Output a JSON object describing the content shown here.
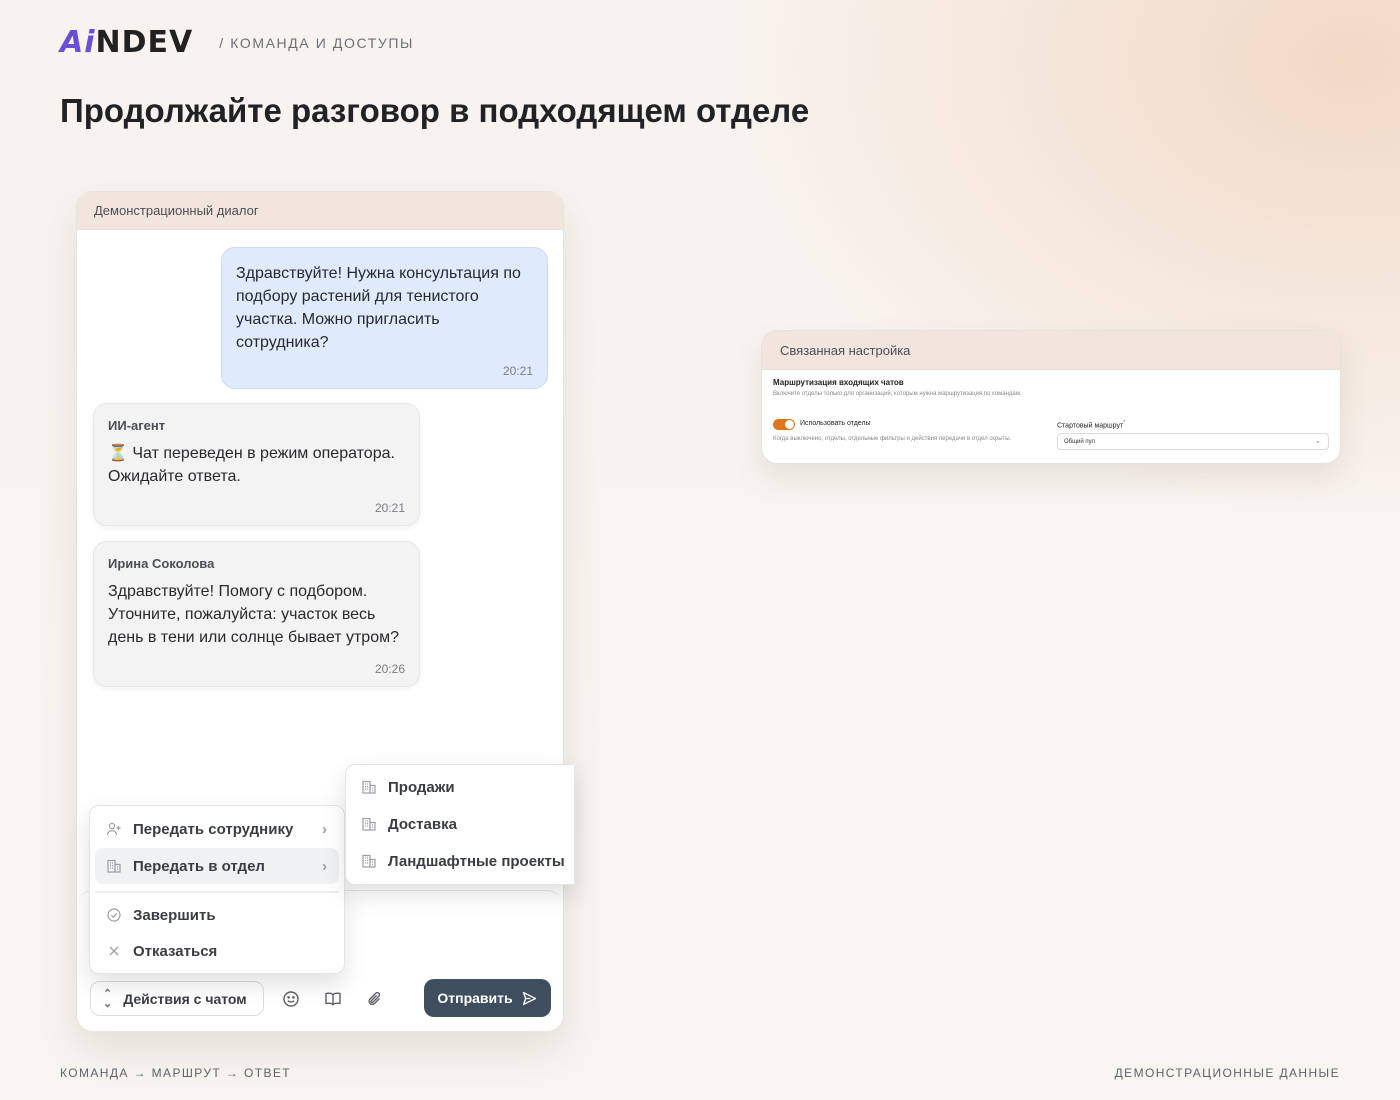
{
  "brand": {
    "logo_ai": "Ai",
    "logo_rest": "NDEV",
    "crumb": "/ КОМАНДА И ДОСТУПЫ"
  },
  "headline": "Продолжайте разговор в подходящем отделе",
  "chat": {
    "header": "Демонстрационный диалог",
    "messages": [
      {
        "text": "Здравствуйте! Нужна консультация по подбору растений для тенистого участка. Можно пригласить сотрудника?",
        "time": "20:21"
      },
      {
        "sender": "ИИ-агент",
        "text": "⏳ Чат переведен в режим оператора. Ожидайте ответа.",
        "time": "20:21"
      },
      {
        "sender": "Ирина Соколова",
        "text": "Здравствуйте! Помогу с подбором. Уточните, пожалуйста: участок весь день в тени или солнце бывает утром?",
        "time": "20:26"
      }
    ],
    "menu": {
      "transfer_employee": "Передать сотруднику",
      "transfer_department": "Передать в отдел",
      "finish": "Завершить",
      "decline": "Отказаться"
    },
    "departments": [
      "Продажи",
      "Доставка",
      "Ландшафтные проекты"
    ],
    "actions_label": "Действия с чатом",
    "send_label": "Отправить"
  },
  "settings": {
    "header": "Связанная настройка",
    "title": "Маршрутизация входящих чатов",
    "description": "Включите отделы только для организаций, которым нужна маршрутизация по командам.",
    "toggle_label": "Использовать отделы",
    "toggle_on": true,
    "toggle_hint": "Когда выключено, отделы, отдельные фильтры и действия передачи в отдел скрыты.",
    "route_label": "Стартовый маршрут",
    "route_value": "Общий пул"
  },
  "footer": {
    "left": "КОМАНДА → МАРШРУТ → ОТВЕТ",
    "right": "ДЕМОНСТРАЦИОННЫЕ ДАННЫЕ"
  },
  "colors": {
    "accent": "#e0761c",
    "user_bubble": "#dfeafc",
    "send_button": "#3f4e5e",
    "logo_accent": "#6a4fd6"
  }
}
